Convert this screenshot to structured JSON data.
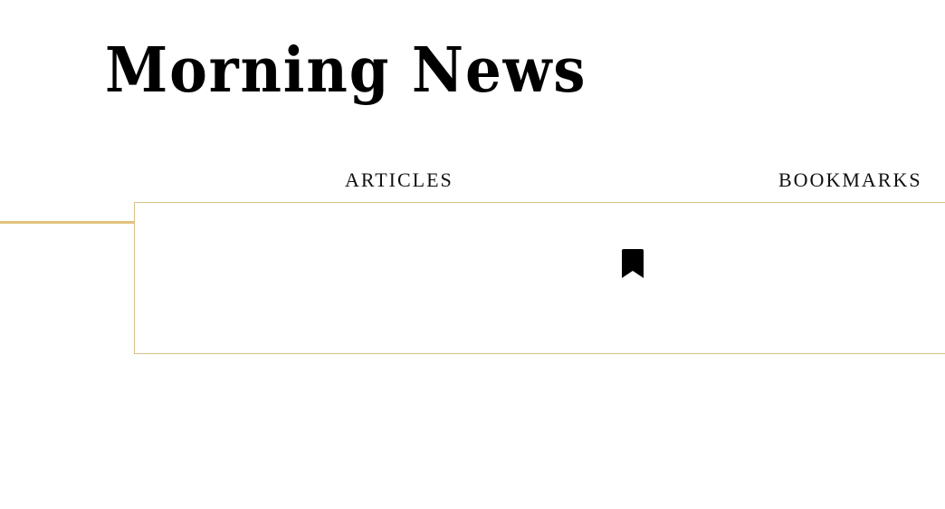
{
  "masthead": {
    "title": "Morning News"
  },
  "tabs": [
    {
      "label": "ARTICLES"
    },
    {
      "label": "BOOKMARKS"
    }
  ],
  "icons": {
    "bookmark": "bookmark-icon"
  },
  "colors": {
    "accent": "#e0c27a",
    "panel_border": "#d9c28a",
    "text": "#111111"
  }
}
